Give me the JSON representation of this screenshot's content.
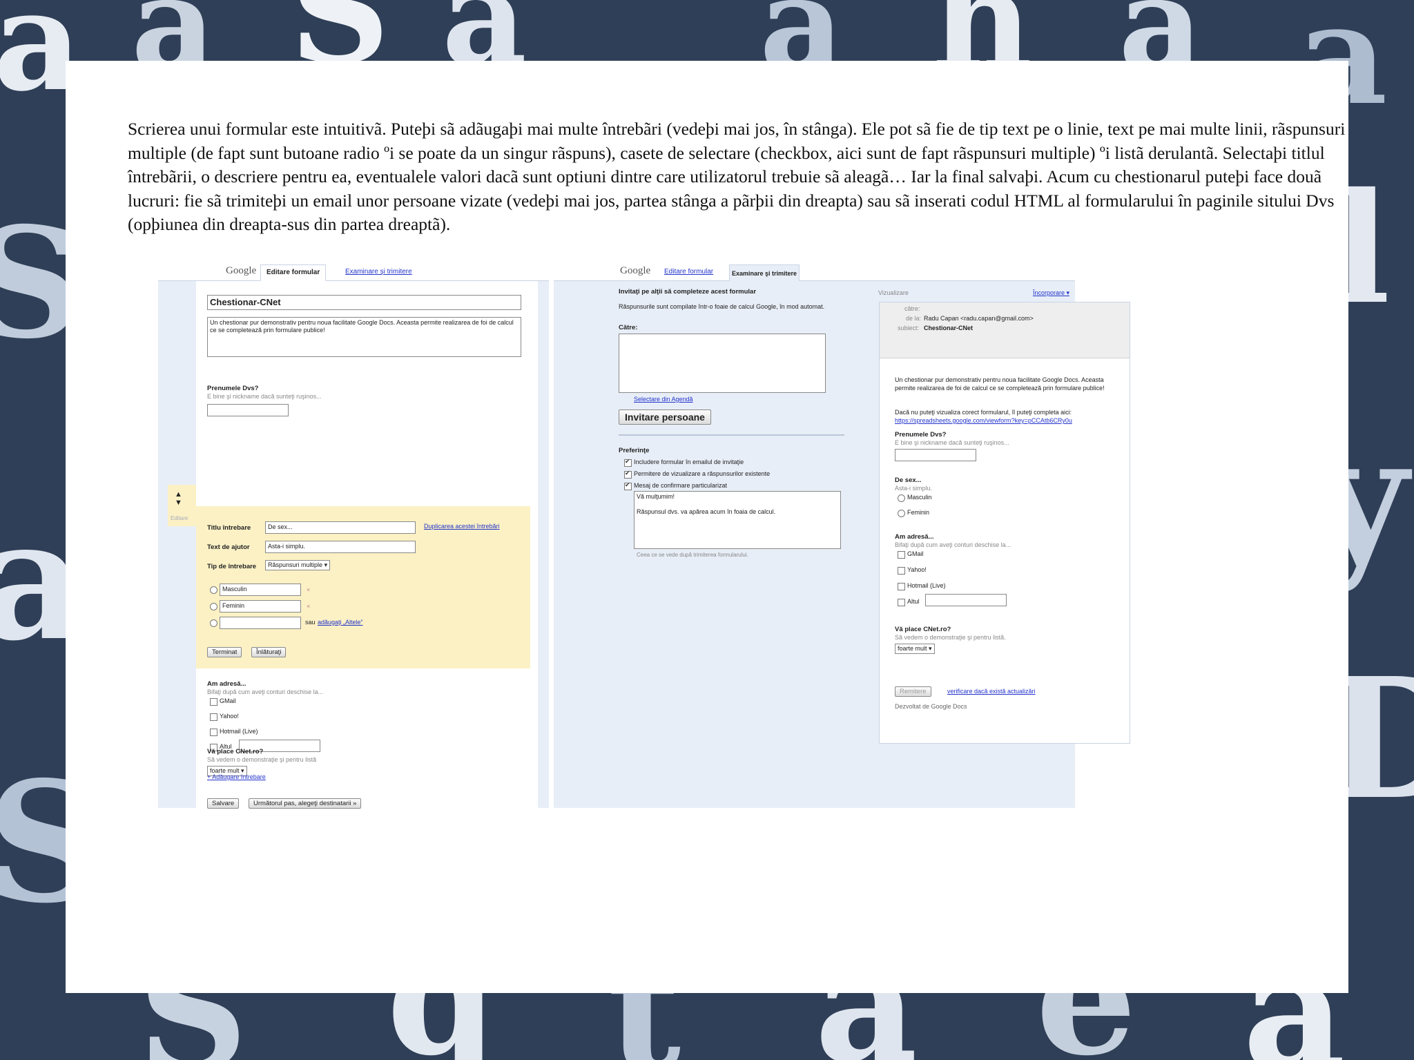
{
  "paragraph": "Scrierea unui formular este intuitivã. Puteþi sã adãugaþi mai multe întrebãri (vedeþi mai jos, în stânga). Ele pot sã fie de tip text pe o linie, text pe mai multe linii, rãspunsuri multiple (de fapt sunt butoane radio ºi se poate da un singur rãspuns), casete de selectare (checkbox, aici sunt de fapt rãspunsuri multiple) ºi listã derulantã. Selectaþi titlul întrebãrii, o descriere pentru ea, eventualele valori dacã sunt optiuni dintre care utilizatorul trebuie sã aleagã… Iar la final salvaþi. Acum cu chestionarul puteþi face douã lucruri: fie sã trimiteþi un email unor persoane vizate (vedeþi mai jos, partea stânga a pãrþii din dreapta) sau sã inserati codul HTML al formularului în paginile sitului Dvs (opþiunea din dreapta-sus din partea dreaptã).",
  "left": {
    "logo": "Google",
    "tab_edit": "Editare formular",
    "tab_review": "Examinare şi trimitere",
    "form_title": "Chestionar-CNet",
    "form_desc": "Un chestionar pur demonstrativ pentru noua facilitate Google Docs. Aceasta permite realizarea de foi de calcul ce se completează prin formulare publice!",
    "q1_label": "Prenumele Dvs?",
    "q1_hint": "E bine şi nickname dacă sunteţi ruşinos...",
    "edit": {
      "title_label": "Titlu întrebare",
      "title_value": "De sex...",
      "duplicate": "Duplicarea acestei întrebări",
      "help_label": "Text de ajutor",
      "help_value": "Asta-i simplu.",
      "type_label": "Tip de întrebare",
      "type_value": "Răspunsuri multiple",
      "opt1": "Masculin",
      "opt2": "Feminin",
      "or": "sau",
      "add_other": "adăugaţi „Altele”",
      "done": "Terminat",
      "remove": "Înlăturaţi",
      "side": "Editare"
    },
    "q3_label": "Am adresă...",
    "q3_hint": "Bifaţi după cum aveţi conturi deschise la...",
    "q3_opts": [
      "GMail",
      "Yahoo!",
      "Hotmail (Live)",
      "Altul"
    ],
    "q4_label": "Vă place CNet.ro?",
    "q4_hint": "Să vedem o demonstraţie şi pentru listă",
    "q4_value": "foarte mult",
    "add_question": "+ Adăugare întrebare",
    "save": "Salvare",
    "next": "Următorul pas, alegeţi destinatarii »"
  },
  "right": {
    "logo": "Google",
    "tab_edit": "Editare formular",
    "tab_review": "Examinare şi trimitere",
    "invite_title": "Invitaţi pe alţii să completeze acest formular",
    "invite_desc": "Răspunsurile sunt compilate într-o foaie de calcul Google, în mod automat.",
    "to_label": "Către:",
    "address_book": "Selectare din Agendă",
    "invite_btn": "Invitare persoane",
    "prefs_title": "Preferinţe",
    "prefs": [
      "Includere formular în emailul de invitaţie",
      "Permitere de vizualizare a răspunsurilor existente",
      "Mesaj de confirmare particularizat"
    ],
    "confirm_text1": "Vă mulţumim!",
    "confirm_text2": "Răspunsul dvs. va apărea acum în foaia de calcul.",
    "confirm_hint": "Ceea ce se vede după trimiterea formularului.",
    "preview_label": "Vizualizare",
    "embed": "Încorporare ▾",
    "to_field": "către:",
    "from_label": "de la:",
    "from_value": "Radu Capan <radu.capan@gmail.com>",
    "subject_label": "subiect:",
    "subject_value": "Chestionar-CNet",
    "pv_desc": "Un chestionar pur demonstrativ pentru noua facilitate Google Docs. Aceasta permite realizarea de foi de calcul ce se completează prin formulare publice!",
    "pv_link_intro": "Dacă nu puteţi vizualiza corect formularul, îl puteţi completa aici:",
    "pv_link": "https://spreadsheets.google.com/viewform?key=pCCAtb6CRy0u",
    "q1_label": "Prenumele Dvs?",
    "q1_hint": "E bine şi nickname dacă sunteţi ruşinos...",
    "q2_label": "De sex...",
    "q2_hint": "Asta-i simplu.",
    "q2_opts": [
      "Masculin",
      "Feminin"
    ],
    "q3_label": "Am adresă...",
    "q3_hint": "Bifaţi după cum aveţi conturi deschise la...",
    "q3_opts": [
      "GMail",
      "Yahoo!",
      "Hotmail (Live)",
      "Altul"
    ],
    "q4_label": "Vă place CNet.ro?",
    "q4_hint": "Să vedem o demonstraţie şi pentru listă.",
    "q4_value": "foarte mult",
    "submit": "Remitere",
    "check_updates": "verificare dacă există actualizări",
    "powered": "Dezvoltat de Google Docs"
  }
}
